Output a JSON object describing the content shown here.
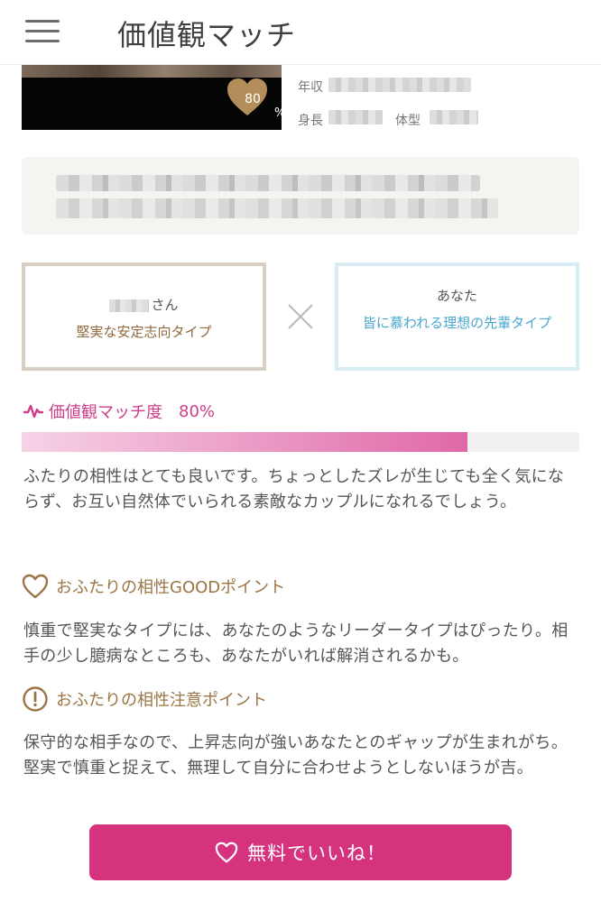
{
  "header": {
    "title": "価値観マッチ"
  },
  "profile": {
    "match_badge": {
      "value": "80",
      "unit": "%"
    },
    "income_label": "年収",
    "height_label": "身長",
    "body_type_label": "体型"
  },
  "types": {
    "partner": {
      "name_suffix": "さん",
      "type": "堅実な安定志向タイプ"
    },
    "you": {
      "name": "あなた",
      "type": "皆に慕われる理想の先輩タイプ"
    }
  },
  "match": {
    "label": "価値観マッチ度",
    "percent_text": "80%",
    "percent": 80,
    "description": "ふたりの相性はとても良いです。ちょっとしたズレが生じても全く気にならず、お互い自然体でいられる素敵なカップルになれるでしょう。"
  },
  "good": {
    "title": "おふたりの相性GOODポイント",
    "text": "慎重で堅実なタイプには、あなたのようなリーダータイプはぴったり。相手の少し臆病なところも、あなたがいれば解消されるかも。"
  },
  "caution": {
    "title": "おふたりの相性注意ポイント",
    "text": "保守的な相手なので、上昇志向が強いあなたとのギャップが生まれがち。堅実で慎重と捉えて、無理して自分に合わせようとしないほうが吉。"
  },
  "cta": {
    "label": "無料でいいね！"
  },
  "colors": {
    "accent_pink": "#d6337f",
    "brown": "#9a7545",
    "blue": "#4aa7cf"
  }
}
